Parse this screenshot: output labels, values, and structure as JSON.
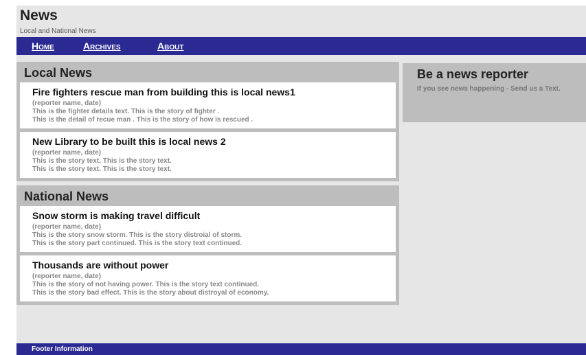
{
  "site": {
    "title": "News",
    "subtitle": "Local and National News"
  },
  "nav": {
    "items": [
      {
        "label": "Home"
      },
      {
        "label": "Archives"
      },
      {
        "label": "About"
      }
    ]
  },
  "local": {
    "heading": "Local News",
    "stories": [
      {
        "headline": "Fire fighters rescue man from building this is local news1",
        "meta": "(reporter name, date)",
        "line1": "This is the fighter details text. This is the story of fighter .",
        "line2": "This is the detail of recue man . This is the story of how is rescued ."
      },
      {
        "headline": "New Library to be built this is local news 2",
        "meta": "(reporter name, date)",
        "line1": "This is the story text. This is the story text.",
        "line2": "This is the story text. This is the story text."
      }
    ]
  },
  "national": {
    "heading": "National News",
    "stories": [
      {
        "headline": "Snow storm is making travel difficult",
        "meta": "(reporter name, date)",
        "line1": "This is the story snow storm. This is the story distroial of storm.",
        "line2": "This is the story part continued. This is the story text continued."
      },
      {
        "headline": "Thousands are without power",
        "meta": "(reporter name, date)",
        "line1": "This is the story of not having power. This is the story text continued.",
        "line2": "This is the story bad effect. This is the story about distroyal of economy."
      }
    ]
  },
  "sidebar": {
    "title": "Be a news reporter",
    "text": "If you see news happening - Send us a Text."
  },
  "footer": {
    "text": "Footer Information"
  },
  "colors": {
    "nav_bg": "#2b2a93",
    "page_bg": "#e6e6e6",
    "panel_bg": "#bdbdbd"
  }
}
